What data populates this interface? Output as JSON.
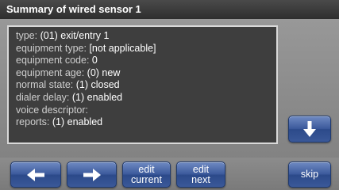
{
  "title": "Summary of wired sensor 1",
  "details": [
    {
      "label": "type:",
      "value": "(01) exit/entry 1"
    },
    {
      "label": "equipment type:",
      "value": "[not applicable]"
    },
    {
      "label": "equipment code:",
      "value": "0"
    },
    {
      "label": "equipment age:",
      "value": "(0) new"
    },
    {
      "label": "normal state:",
      "value": "(1) closed"
    },
    {
      "label": "dialer delay:",
      "value": "(1) enabled"
    },
    {
      "label": "voice descriptor:",
      "value": ""
    },
    {
      "label": "reports:",
      "value": "(1) enabled"
    }
  ],
  "buttons": {
    "scroll_down_icon": "arrow-down-icon",
    "previous_icon": "arrow-left-icon",
    "next_icon": "arrow-right-icon",
    "edit_current": {
      "line1": "edit",
      "line2": "current"
    },
    "edit_next": {
      "line1": "edit",
      "line2": "next"
    },
    "skip": "skip"
  },
  "colors": {
    "title_bar": "#2e2e2e",
    "panel": "#3e3e3e",
    "button_blue": "#3c5a9c",
    "background": "#8e8e8e"
  }
}
